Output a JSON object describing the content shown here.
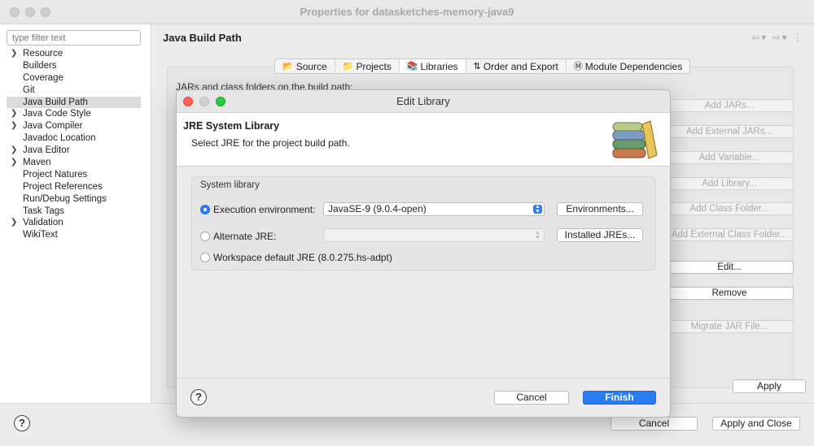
{
  "window": {
    "title": "Properties for datasketches-memory-java9"
  },
  "sidebar": {
    "filter_placeholder": "type filter text",
    "items": [
      {
        "label": "Resource",
        "expandable": true
      },
      {
        "label": "Builders",
        "expandable": false
      },
      {
        "label": "Coverage",
        "expandable": false
      },
      {
        "label": "Git",
        "expandable": false
      },
      {
        "label": "Java Build Path",
        "expandable": false,
        "selected": true
      },
      {
        "label": "Java Code Style",
        "expandable": true
      },
      {
        "label": "Java Compiler",
        "expandable": true
      },
      {
        "label": "Javadoc Location",
        "expandable": false
      },
      {
        "label": "Java Editor",
        "expandable": true
      },
      {
        "label": "Maven",
        "expandable": true
      },
      {
        "label": "Project Natures",
        "expandable": false
      },
      {
        "label": "Project References",
        "expandable": false
      },
      {
        "label": "Run/Debug Settings",
        "expandable": false
      },
      {
        "label": "Task Tags",
        "expandable": false
      },
      {
        "label": "Validation",
        "expandable": true
      },
      {
        "label": "WikiText",
        "expandable": false
      }
    ]
  },
  "page": {
    "title": "Java Build Path",
    "tabs": [
      {
        "label": "Source",
        "icon": "source-folder-icon"
      },
      {
        "label": "Projects",
        "icon": "projects-icon"
      },
      {
        "label": "Libraries",
        "icon": "libraries-icon",
        "active": true
      },
      {
        "label": "Order and Export",
        "icon": "order-export-icon"
      },
      {
        "label": "Module Dependencies",
        "icon": "module-icon"
      }
    ],
    "jars_label": "JARs and class folders on the build path:",
    "buttons": {
      "add_jars": "Add JARs...",
      "add_external_jars": "Add External JARs...",
      "add_variable": "Add Variable...",
      "add_library": "Add Library...",
      "add_class_folder": "Add Class Folder...",
      "add_external_class_folder": "Add External Class Folder...",
      "edit": "Edit...",
      "remove": "Remove",
      "migrate_jar": "Migrate JAR File..."
    },
    "apply": "Apply"
  },
  "footer": {
    "help": "?",
    "cancel": "Cancel",
    "apply_and_close": "Apply and Close"
  },
  "dialog": {
    "title": "Edit Library",
    "header_title": "JRE System Library",
    "header_message": "Select JRE for the project build path.",
    "group_label": "System library",
    "options": {
      "execution_environment": "Execution environment:",
      "alternate_jre": "Alternate JRE:",
      "workspace_default": "Workspace default JRE (8.0.275.hs-adpt)"
    },
    "selected_option": "execution_environment",
    "execution_environment_value": "JavaSE-9 (9.0.4-open)",
    "alternate_jre_value": "",
    "environments_button": "Environments...",
    "installed_jres_button": "Installed JREs...",
    "help": "?",
    "cancel": "Cancel",
    "finish": "Finish",
    "colors": {
      "accent": "#2a7df1",
      "close": "#ff5f57",
      "minimize": "#d0d0d0",
      "zoom": "#28c840"
    }
  }
}
